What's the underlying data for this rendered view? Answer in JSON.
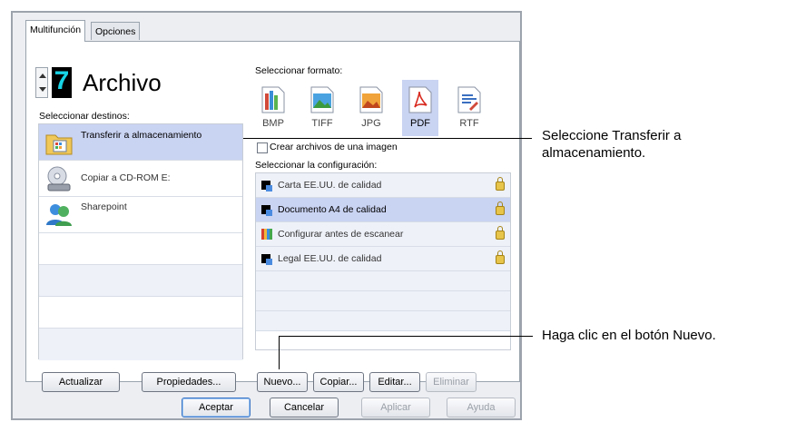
{
  "tabs": [
    "Multifunción",
    "Opciones"
  ],
  "header": {
    "digit": "7",
    "title": "Archivo"
  },
  "destinations": {
    "label": "Seleccionar destinos:",
    "items": [
      "Transferir a almacenamiento",
      "Copiar a CD-ROM  E:",
      "Sharepoint"
    ]
  },
  "format": {
    "label": "Seleccionar formato:",
    "items": [
      "BMP",
      "TIFF",
      "JPG",
      "PDF",
      "RTF"
    ],
    "selected": "PDF"
  },
  "checkbox": {
    "label": "Crear archivos de una imagen",
    "checked": false
  },
  "config": {
    "label": "Seleccionar la configuración:",
    "items": [
      "Carta EE.UU. de calidad",
      "Documento A4 de calidad",
      "Configurar antes de escanear",
      "Legal EE.UU. de calidad"
    ],
    "selected": "Documento A4 de calidad"
  },
  "buttons": {
    "refresh": "Actualizar",
    "properties": "Propiedades...",
    "new": "Nuevo...",
    "copy": "Copiar...",
    "edit": "Editar...",
    "delete": "Eliminar",
    "ok": "Aceptar",
    "cancel": "Cancelar",
    "apply": "Aplicar",
    "help": "Ayuda"
  },
  "callouts": {
    "transfer": "Seleccione Transferir a almacenamiento.",
    "new": "Haga clic en el botón Nuevo."
  },
  "colors": {
    "selection": "#c9d3f2",
    "accent_digit": "#17d4e6"
  }
}
